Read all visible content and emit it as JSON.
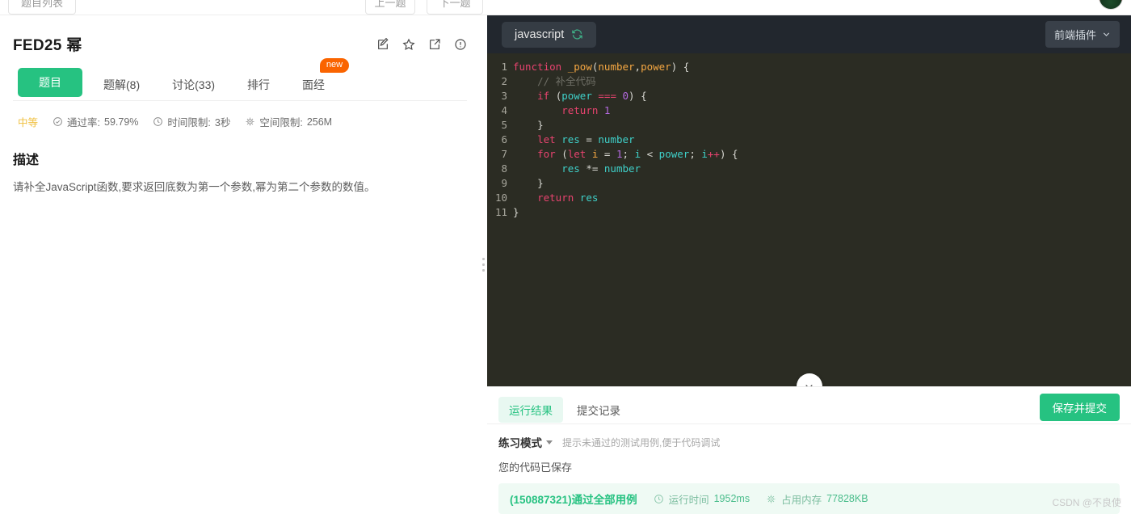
{
  "topbar": {
    "chips": [
      "题目列表",
      "上一题",
      "下一题"
    ]
  },
  "problem": {
    "title": "FED25 幂",
    "title_icons": [
      "edit-icon",
      "star-icon",
      "external-link-icon",
      "info-icon"
    ],
    "tabs": [
      {
        "label": "题目",
        "active": true,
        "badge": ""
      },
      {
        "label": "题解(8)",
        "active": false,
        "badge": ""
      },
      {
        "label": "讨论(33)",
        "active": false,
        "badge": ""
      },
      {
        "label": "排行",
        "active": false,
        "badge": ""
      },
      {
        "label": "面经",
        "active": false,
        "badge": "new"
      }
    ],
    "meta": {
      "difficulty": "中等",
      "pass_rate_label": "通过率:",
      "pass_rate_value": "59.79%",
      "time_limit_label": "时间限制:",
      "time_limit_value": "3秒",
      "space_limit_label": "空间限制:",
      "space_limit_value": "256M"
    },
    "description_title": "描述",
    "description_body": "请补全JavaScript函数,要求返回底数为第一个参数,幂为第二个参数的数值。"
  },
  "editor": {
    "language_tab": "javascript",
    "refresh_icon": "refresh-icon",
    "plugin_button": "前端插件",
    "code_lines": [
      {
        "n": "1",
        "tokens": [
          {
            "t": "function",
            "c": "k-kw"
          },
          {
            "t": " ",
            "c": "k-pn"
          },
          {
            "t": "_pow",
            "c": "k-fn"
          },
          {
            "t": "(",
            "c": "k-pn"
          },
          {
            "t": "number",
            "c": "k-id"
          },
          {
            "t": ",",
            "c": "k-pn"
          },
          {
            "t": "power",
            "c": "k-id"
          },
          {
            "t": ") {",
            "c": "k-pn"
          }
        ]
      },
      {
        "n": "2",
        "tokens": [
          {
            "t": "    // 补全代码",
            "c": "k-cm"
          }
        ]
      },
      {
        "n": "3",
        "tokens": [
          {
            "t": "    ",
            "c": "k-pn"
          },
          {
            "t": "if",
            "c": "k-kw"
          },
          {
            "t": " (",
            "c": "k-pn"
          },
          {
            "t": "power",
            "c": "k-var"
          },
          {
            "t": " === ",
            "c": "k-op"
          },
          {
            "t": "0",
            "c": "k-num"
          },
          {
            "t": ") {",
            "c": "k-pn"
          }
        ]
      },
      {
        "n": "4",
        "tokens": [
          {
            "t": "        ",
            "c": "k-pn"
          },
          {
            "t": "return",
            "c": "k-kw"
          },
          {
            "t": " ",
            "c": "k-pn"
          },
          {
            "t": "1",
            "c": "k-num"
          }
        ]
      },
      {
        "n": "5",
        "tokens": [
          {
            "t": "    }",
            "c": "k-pn"
          }
        ]
      },
      {
        "n": "6",
        "tokens": [
          {
            "t": "    ",
            "c": "k-pn"
          },
          {
            "t": "let",
            "c": "k-kw"
          },
          {
            "t": " ",
            "c": "k-pn"
          },
          {
            "t": "res",
            "c": "k-var"
          },
          {
            "t": " = ",
            "c": "k-pn"
          },
          {
            "t": "number",
            "c": "k-var"
          }
        ]
      },
      {
        "n": "7",
        "tokens": [
          {
            "t": "    ",
            "c": "k-pn"
          },
          {
            "t": "for",
            "c": "k-kw"
          },
          {
            "t": " (",
            "c": "k-pn"
          },
          {
            "t": "let",
            "c": "k-kw"
          },
          {
            "t": " ",
            "c": "k-pn"
          },
          {
            "t": "i",
            "c": "k-id"
          },
          {
            "t": " = ",
            "c": "k-pn"
          },
          {
            "t": "1",
            "c": "k-num"
          },
          {
            "t": "; ",
            "c": "k-pn"
          },
          {
            "t": "i",
            "c": "k-var"
          },
          {
            "t": " < ",
            "c": "k-pn"
          },
          {
            "t": "power",
            "c": "k-var"
          },
          {
            "t": "; ",
            "c": "k-pn"
          },
          {
            "t": "i",
            "c": "k-var"
          },
          {
            "t": "++",
            "c": "k-op"
          },
          {
            "t": ") {",
            "c": "k-pn"
          }
        ]
      },
      {
        "n": "8",
        "tokens": [
          {
            "t": "        ",
            "c": "k-pn"
          },
          {
            "t": "res",
            "c": "k-var"
          },
          {
            "t": " *= ",
            "c": "k-pn"
          },
          {
            "t": "number",
            "c": "k-var"
          }
        ]
      },
      {
        "n": "9",
        "tokens": [
          {
            "t": "    }",
            "c": "k-pn"
          }
        ]
      },
      {
        "n": "10",
        "tokens": [
          {
            "t": "    ",
            "c": "k-pn"
          },
          {
            "t": "return",
            "c": "k-kw"
          },
          {
            "t": " ",
            "c": "k-pn"
          },
          {
            "t": "res",
            "c": "k-var"
          }
        ]
      },
      {
        "n": "11",
        "tokens": [
          {
            "t": "}",
            "c": "k-pn"
          }
        ]
      }
    ]
  },
  "results": {
    "tabs": [
      {
        "label": "运行结果",
        "active": true
      },
      {
        "label": "提交记录",
        "active": false
      }
    ],
    "submit_button": "保存并提交",
    "mode_name": "练习模式",
    "mode_hint": "提示未通过的测试用例,便于代码调试",
    "saved_note": "您的代码已保存",
    "pass_text": "(150887321)通过全部用例",
    "runtime_label": "运行时间",
    "runtime_value": "1952ms",
    "memory_label": "占用内存",
    "memory_value": "77828KB"
  },
  "watermark": "CSDN @不良使",
  "colors": {
    "accent_green": "#26c281",
    "badge_orange": "#fa6400",
    "difficulty_yellow": "#f0c040",
    "editor_bg": "#2b2c23",
    "editor_header_bg": "#22272e"
  }
}
